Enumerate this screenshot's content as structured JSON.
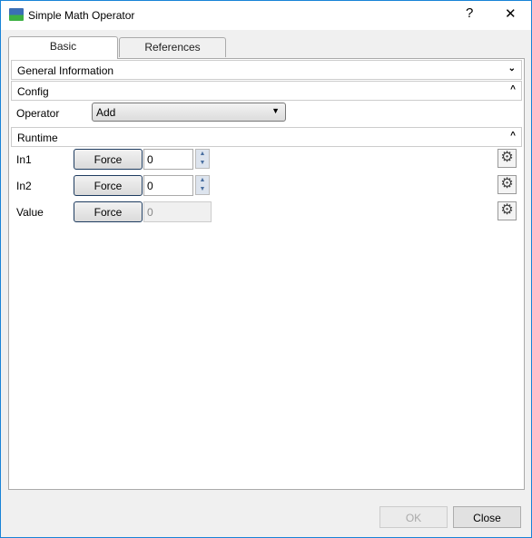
{
  "window": {
    "title": "Simple Math Operator",
    "help": "?",
    "close": "✕"
  },
  "tabs": [
    {
      "label": "Basic",
      "active": true
    },
    {
      "label": "References",
      "active": false
    }
  ],
  "sections": {
    "general": "General Information",
    "config": "Config",
    "runtime": "Runtime"
  },
  "config": {
    "operator_label": "Operator",
    "operator_value": "Add"
  },
  "runtime": {
    "force_label": "Force",
    "rows": [
      {
        "label": "In1",
        "value": "0"
      },
      {
        "label": "In2",
        "value": "0"
      },
      {
        "label": "Value",
        "value": "0"
      }
    ]
  },
  "footer": {
    "ok": "OK",
    "close": "Close"
  }
}
